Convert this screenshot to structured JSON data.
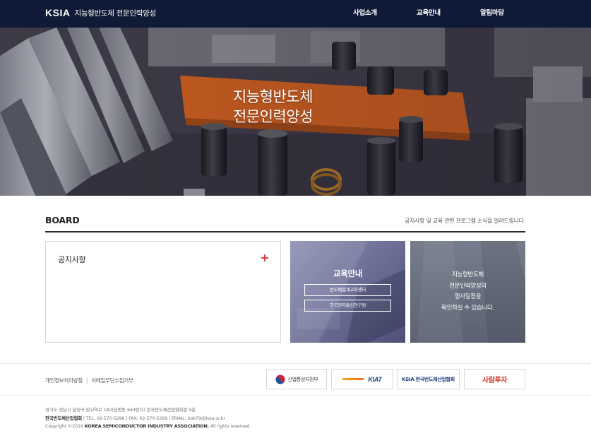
{
  "header": {
    "logo_mark": "KSIA",
    "logo_text": "지능형반도체 전문인력양성",
    "nav": [
      "사업소개",
      "교육안내",
      "알림마당"
    ]
  },
  "hero": {
    "title_line1": "지능형반도체",
    "title_line2": "전문인력양성"
  },
  "board": {
    "title": "BOARD",
    "description": "공지사항 및 교육 관련 프로그램 소식을 알려드립니다.",
    "notice_title": "공지사항",
    "edu": {
      "title": "교육안내",
      "buttons": [
        "반도체설계교육센터",
        "한국전자통신연구원"
      ]
    },
    "event": {
      "lines": [
        "지능형반도체",
        "전문인력양성의",
        "행사일정을",
        "확인하실 수 있습니다."
      ]
    }
  },
  "footer": {
    "links": [
      "개인정보처리방침",
      "이메일무단수집거부"
    ],
    "partners": [
      "산업통상자원부",
      "KIAT",
      "KSIA 한국반도체산업협회",
      "사람투자"
    ],
    "address": "경기도 성남시 분당구 판교역로 182(삼평동 644번지) 한국반도체산업협회관 9층",
    "org": "한국반도체산업협회",
    "contact": "TEL: 02-570-5296  |  FAX: 02-570-5269  |  EMAIL: hob79@ksia.or.kr",
    "copyright_prefix": "Copyright ©2019",
    "copyright_org": "KOREA SEMICONDUCTOR INDUSTRY ASSOCIATION.",
    "copyright_suffix": "All rights reserved."
  },
  "colors": {
    "header_bg": "#0e1a36",
    "accent_plus": "#e03e3e",
    "edu_bg": "#6f7199",
    "event_bg": "#686f7e"
  }
}
